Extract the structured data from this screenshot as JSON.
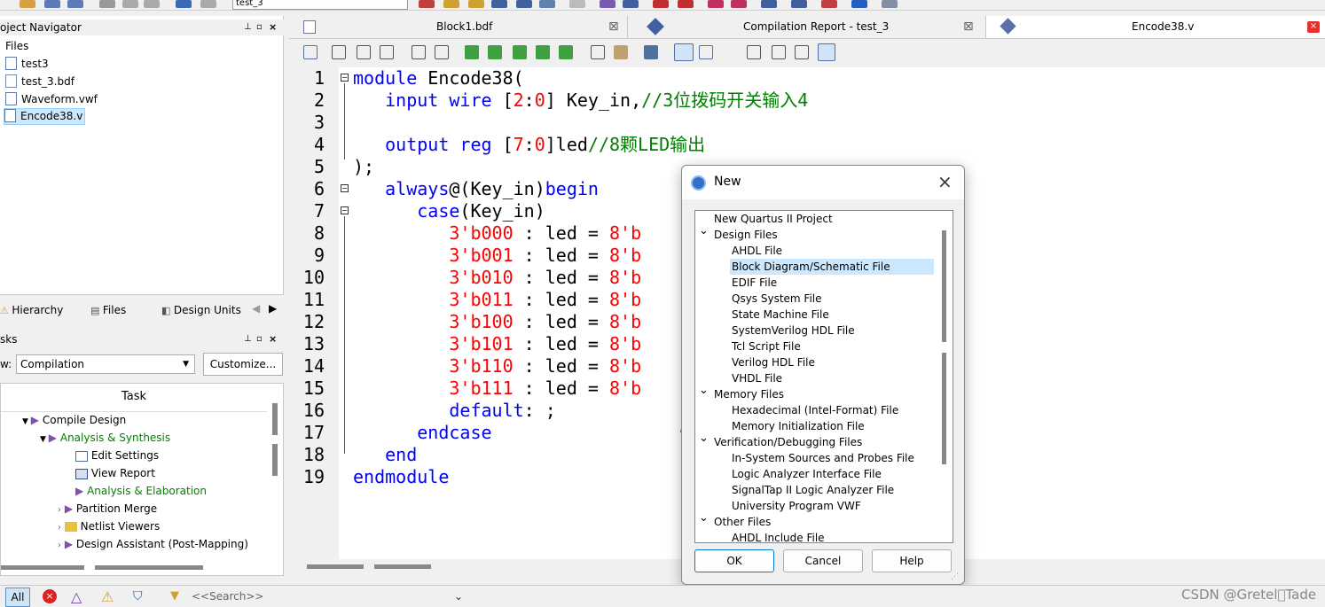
{
  "toolbar": {
    "project_select": "test_3"
  },
  "project_navigator": {
    "title": "oject Navigator",
    "section": "Files",
    "files": [
      {
        "name": "test3",
        "icon": "document-icon"
      },
      {
        "name": "test_3.bdf",
        "icon": "bdf-file-icon"
      },
      {
        "name": "Waveform.vwf",
        "icon": "document-icon"
      },
      {
        "name": "Encode38.v",
        "icon": "verilog-file-icon"
      }
    ],
    "tabs": [
      "Hierarchy",
      "Files",
      "Design Units"
    ]
  },
  "tasks": {
    "title": "sks",
    "flow_label": "w:",
    "flow_value": "Compilation",
    "customize_label": "Customize...",
    "column_header": "Task",
    "rows": [
      {
        "label": "Compile Design",
        "color": "#000000"
      },
      {
        "label": "Analysis & Synthesis",
        "color": "#008000"
      },
      {
        "label": "Edit Settings",
        "color": "#000000"
      },
      {
        "label": "View Report",
        "color": "#000000"
      },
      {
        "label": "Analysis & Elaboration",
        "color": "#008000"
      },
      {
        "label": "Partition Merge",
        "color": "#000000"
      },
      {
        "label": "Netlist Viewers",
        "color": "#000000"
      },
      {
        "label": "Design Assistant (Post-Mapping)",
        "color": "#000000"
      }
    ]
  },
  "doc_tabs": [
    {
      "label": "Block1.bdf"
    },
    {
      "label": "Compilation Report - test_3"
    },
    {
      "label": "Encode38.v"
    }
  ],
  "editor": {
    "line_numbers": [
      "1",
      "2",
      "3",
      "4",
      "5",
      "6",
      "7",
      "8",
      "9",
      "10",
      "11",
      "12",
      "13",
      "14",
      "15",
      "16",
      "17",
      "18",
      "19"
    ],
    "lines": {
      "l1_kw": "module",
      "l1_rest": " Encode38(",
      "l2_a": "input wire ",
      "l2_b": "[",
      "l2_c": "2",
      "l2_d": ":",
      "l2_e": "0",
      "l2_f": "] Key_in,",
      "l2_cm": "//3位拨码开关输入4",
      "l4_a": "output reg ",
      "l4_b": "[",
      "l4_c": "7",
      "l4_d": ":",
      "l4_e": "0",
      "l4_f": "]led",
      "l4_cm": "//8颗LED输出",
      "l5": ");",
      "l6_kw": "always",
      "l6_rest": "@(Key_in)",
      "l6_kw2": "begin",
      "l7_kw": "case",
      "l7_rest": "(Key_in)",
      "cases": [
        "3'b000",
        "3'b001",
        "3'b010",
        "3'b011",
        "3'b100",
        "3'b101",
        "3'b110",
        "3'b111"
      ],
      "case_mid": " : led = ",
      "case_val": "8'b",
      "l16_kw": "default",
      ":l16": ": ;",
      "l16_rest": ": ;",
      "l17": "endcase",
      "l18": "end",
      "l19": "endmodule"
    }
  },
  "dialog": {
    "title": "New",
    "tree": [
      {
        "label": "New Quartus II Project",
        "level": 0
      },
      {
        "label": "Design Files",
        "level": 0,
        "expanded": true
      },
      {
        "label": "AHDL File",
        "level": 1
      },
      {
        "label": "Block Diagram/Schematic File",
        "level": 1,
        "selected": true
      },
      {
        "label": "EDIF File",
        "level": 1
      },
      {
        "label": "Qsys System File",
        "level": 1
      },
      {
        "label": "State Machine File",
        "level": 1
      },
      {
        "label": "SystemVerilog HDL File",
        "level": 1
      },
      {
        "label": "Tcl Script File",
        "level": 1
      },
      {
        "label": "Verilog HDL File",
        "level": 1
      },
      {
        "label": "VHDL File",
        "level": 1
      },
      {
        "label": "Memory Files",
        "level": 0,
        "expanded": true
      },
      {
        "label": "Hexadecimal (Intel-Format) File",
        "level": 1
      },
      {
        "label": "Memory Initialization File",
        "level": 1
      },
      {
        "label": "Verification/Debugging Files",
        "level": 0,
        "expanded": true
      },
      {
        "label": "In-System Sources and Probes File",
        "level": 1
      },
      {
        "label": "Logic Analyzer Interface File",
        "level": 1
      },
      {
        "label": "SignalTap II Logic Analyzer File",
        "level": 1
      },
      {
        "label": "University Program VWF",
        "level": 1
      },
      {
        "label": "Other Files",
        "level": 0,
        "expanded": true
      },
      {
        "label": "AHDL Include File",
        "level": 1
      }
    ],
    "ok": "OK",
    "cancel": "Cancel",
    "help": "Help"
  },
  "messages": {
    "all_label": "All",
    "search_placeholder": "<<Search>>"
  },
  "watermark": "CSDN @Gretel\u0000Tade",
  "colors": {
    "accent_red": "#e8302a",
    "selection": "#cce8ff"
  }
}
